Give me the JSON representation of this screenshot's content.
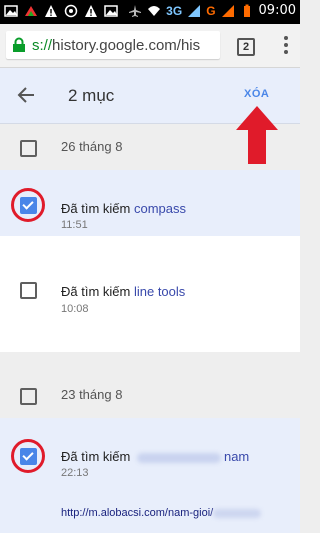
{
  "status_bar": {
    "network_3g": "3G",
    "network_g": "G",
    "time": "09:00"
  },
  "browser": {
    "url_scheme": "s://",
    "url_rest": "history.google.com/his",
    "tab_count": "2"
  },
  "action_bar": {
    "selection_count": "2 mục",
    "delete_label": "XÓA"
  },
  "history": {
    "groups": [
      {
        "date": "26 tháng 8",
        "entries": [
          {
            "prefix": "Đã tìm kiếm ",
            "query": "compass",
            "time": "11:51",
            "selected": true
          },
          {
            "prefix": "Đã tìm kiếm ",
            "query": "line tools",
            "time": "10:08",
            "selected": false
          }
        ]
      },
      {
        "date": "23 tháng 8",
        "entries": [
          {
            "prefix": "Đã tìm kiếm ",
            "query": "nam",
            "time": "22:13",
            "selected": true,
            "url": "http://m.alobacsi.com/nam-gioi/"
          }
        ]
      }
    ]
  },
  "colors": {
    "accent": "#4a86e8",
    "selected_bg": "#e8eefb",
    "annotation_red": "#e01b2a"
  }
}
